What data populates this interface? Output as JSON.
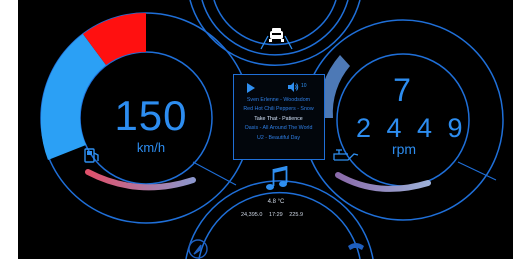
{
  "speedometer": {
    "value": "150",
    "unit": "km/h",
    "fuel_level": 0.6
  },
  "tachometer": {
    "gear": "7",
    "rpm_value": "2449",
    "rpm_display": "2 4 4 9",
    "unit": "rpm",
    "oil_temp_level": 0.55
  },
  "media": {
    "volume": "10",
    "tracks": [
      {
        "title": "Sven Erlenne - Woodsdom",
        "active": false
      },
      {
        "title": "Red Hot Chili Peppers - Snow",
        "active": false
      },
      {
        "title": "Take That - Patience",
        "active": true
      },
      {
        "title": "Oasis - All Around The World",
        "active": false
      },
      {
        "title": "U2 - Beautiful Day",
        "active": false
      }
    ]
  },
  "trip": {
    "temperature": "4.8 °C",
    "odometer": "24,395.0",
    "time": "17:29",
    "range": "225.9"
  },
  "colors": {
    "accent": "#1f6fd8",
    "speed_arc": "#ff1010",
    "speed_arc_low": "#2ba0f5",
    "background": "#000000"
  },
  "icons": [
    "car-icon",
    "fuel-pump-icon",
    "oil-can-icon",
    "music-note-icon",
    "compass-icon",
    "phone-icon",
    "play-icon",
    "speaker-icon"
  ]
}
